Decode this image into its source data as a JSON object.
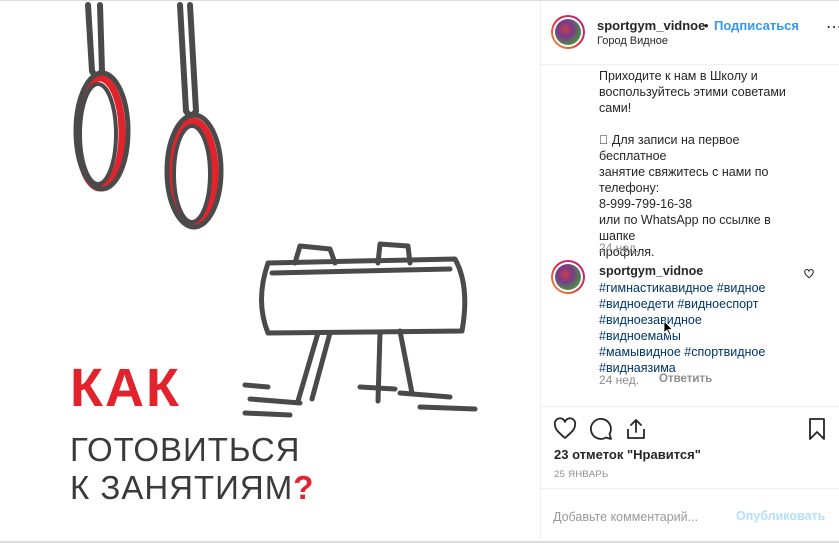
{
  "post": {
    "username": "sportgym_vidnoe",
    "separator": "•",
    "follow_label": "Подписаться",
    "location": "Город Видное",
    "more_label": "⋯"
  },
  "media": {
    "headline_1": "КАК",
    "headline_2": "ГОТОВИТЬСЯ",
    "headline_3": "К ЗАНЯТИЯМ",
    "headline_mark": "?"
  },
  "caption": {
    "text": "Приходите к нам в Школу и\nвоспользуйтесь этими советами\nсами!\n\n\u0000 Для записи на первое бесплатное\nзанятие свяжитесь с нами по\nтелефону:\n8-999-799-16-38\nили по WhatsApp по ссылке в шапке\nпрофиля.",
    "time": "24 нед."
  },
  "comment": {
    "username": "sportgym_vidnoe",
    "hashtags": "#гимнастикавидное #видное\n#видноедети #видноеспорт\n#видноезавидное #видноемамы\n#мамывидное #спортвидное\n#виднаязима",
    "time": "24 нед.",
    "reply_label": "Ответить"
  },
  "actions": {
    "likes": "23 отметок \"Нравится\"",
    "date": "25 ЯНВАРЬ",
    "icons": [
      "heart-icon",
      "comment-icon",
      "share-icon",
      "bookmark-icon"
    ]
  },
  "comment_box": {
    "placeholder": "Добавьте комментарий...",
    "post_label": "Опубликовать"
  },
  "colors": {
    "accent": "#3897f0",
    "headline_red": "#e3232b",
    "hashtag": "#003569",
    "muted": "#8e8e8e"
  }
}
